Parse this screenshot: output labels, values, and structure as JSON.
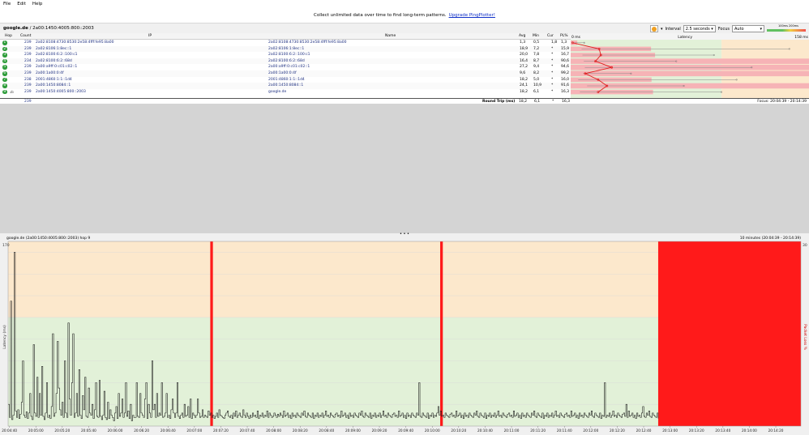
{
  "menu": [
    "File",
    "Edit",
    "Help"
  ],
  "banner": {
    "text": "Collect unlimited data over time to find long-term patterns.",
    "link": "Upgrade PingPlotter!"
  },
  "target": {
    "host": "google.de",
    "ip": "/ 2a00:1450:4005:800::2003"
  },
  "toolbar": {
    "interval_label": "Interval",
    "interval_value": "2.5 seconds",
    "focus_label": "Focus",
    "focus_value": "Auto",
    "legend_low": "100ms",
    "legend_high": "200ms"
  },
  "columns": {
    "hop": "Hop",
    "count": "Count",
    "ip": "IP",
    "name": "Name",
    "avg": "Avg",
    "min": "Min",
    "cur": "Cur",
    "pl": "PL%",
    "latency": "Latency",
    "lat_min": "0 ms",
    "lat_max": "158 ms"
  },
  "hops": [
    {
      "hop": "1",
      "count": "239",
      "ip": "2a02:8108:4730:8530:2e58:4fff:fe95:8a00",
      "name": "2a02:8108:4730:8530:2e58:4fff:fe95:8a00",
      "avg": "1,3",
      "min": "0,5",
      "cur": "1,8",
      "pl": "1,3",
      "plnum": 1.3,
      "avgnum": 1.3,
      "minnum": 0.5,
      "maxnum": 9
    },
    {
      "hop": "2",
      "count": "239",
      "ip": "2a02:8106:1:8ec::1",
      "name": "2a02:8106:1:8ec::1",
      "avg": "18,9",
      "min": "7,2",
      "cur": "*",
      "pl": "15,9",
      "plnum": 15.9,
      "avgnum": 18.9,
      "minnum": 7.2,
      "maxnum": 145
    },
    {
      "hop": "3",
      "count": "239",
      "ip": "2a02:8100:6:2::100:c1",
      "name": "2a02:8100:6:2::100:c1",
      "avg": "20,0",
      "min": "7,8",
      "cur": "*",
      "pl": "16,7",
      "plnum": 16.7,
      "avgnum": 20.0,
      "minnum": 7.8,
      "maxnum": 95
    },
    {
      "hop": "4",
      "count": "234",
      "ip": "2a02:8100:6:2::68d",
      "name": "2a02:8100:6:2::68d",
      "avg": "16,4",
      "min": "8,7",
      "cur": "*",
      "pl": "90,6",
      "plnum": 90.6,
      "avgnum": 16.4,
      "minnum": 8.7,
      "maxnum": 70
    },
    {
      "hop": "5",
      "count": "239",
      "ip": "2a00:a9ff:0:c01:c02::1",
      "name": "2a00:a9ff:0:c01:c02::1",
      "avg": "27,2",
      "min": "9,4",
      "cur": "*",
      "pl": "94,6",
      "plnum": 94.6,
      "avgnum": 27.2,
      "minnum": 9.4,
      "maxnum": 120
    },
    {
      "hop": "6",
      "count": "239",
      "ip": "2a00:1a00:0:4f",
      "name": "2a00:1a00:0:4f",
      "avg": "9,6",
      "min": "8,2",
      "cur": "*",
      "pl": "99,2",
      "plnum": 99.2,
      "avgnum": 9.6,
      "minnum": 8.2,
      "maxnum": 40
    },
    {
      "hop": "7",
      "count": "238",
      "ip": "2001:4860:1:1::1d4",
      "name": "2001:4860:1:1::1d4",
      "avg": "18,2",
      "min": "5,0",
      "cur": "*",
      "pl": "16,0",
      "plnum": 16.0,
      "avgnum": 18.2,
      "minnum": 5.0,
      "maxnum": 110
    },
    {
      "hop": "8",
      "count": "239",
      "ip": "2a00:1450:8084::1",
      "name": "2a00:1450:8084::1",
      "avg": "24,1",
      "min": "10,9",
      "cur": "*",
      "pl": "91,6",
      "plnum": 91.6,
      "avgnum": 24.1,
      "minnum": 10.9,
      "maxnum": 75
    },
    {
      "hop": "9",
      "count": "239",
      "ip": "2a00:1450:4005:800::2003",
      "name": "google.de",
      "avg": "18,2",
      "min": "6,1",
      "cur": "*",
      "pl": "16,3",
      "plnum": 16.3,
      "avgnum": 18.2,
      "minnum": 6.1,
      "maxnum": 100
    }
  ],
  "summary": {
    "count": "239",
    "label": "Round Trip (ms)",
    "avg": "18,2",
    "min": "6,1",
    "cur": "*",
    "pl": "16,3",
    "focus": "Focus: 20:04:39 - 20:14:39"
  },
  "graph": {
    "title": "google.de (2a00:1450:4005:800::2003) hop 9",
    "range": "10 minutes (20:04:39 - 20:14:39)",
    "ylabel": "Latency (ms)",
    "ylabel_right": "Packet Loss %",
    "ymax_label": "170",
    "right_max": "30"
  },
  "chart_data": {
    "type": "line",
    "ylim": [
      0,
      170
    ],
    "y2label": "Packet Loss %",
    "x_ticks": [
      "20:04:40",
      "20:05:00",
      "20:05:20",
      "20:05:40",
      "20:06:00",
      "20:06:20",
      "20:06:40",
      "20:07:00",
      "20:07:20",
      "20:07:40",
      "20:08:00",
      "20:08:20",
      "20:08:40",
      "20:09:00",
      "20:09:20",
      "20:09:40",
      "20:10:00",
      "20:10:20",
      "20:10:40",
      "20:11:00",
      "20:11:20",
      "20:11:40",
      "20:12:00",
      "20:12:20",
      "20:12:40",
      "20:13:00",
      "20:13:20",
      "20:13:40",
      "20:14:00",
      "20:14:20"
    ],
    "loss_events": [
      {
        "start_s": 153,
        "end_s": 155
      },
      {
        "start_s": 327,
        "end_s": 329
      }
    ],
    "loss_region_start_s": 492,
    "total_s": 600,
    "latency": [
      20,
      8,
      115,
      6,
      10,
      160,
      14,
      8,
      15,
      7,
      11,
      22,
      60,
      10,
      8,
      13,
      7,
      12,
      30,
      9,
      6,
      75,
      12,
      9,
      45,
      8,
      30,
      10,
      55,
      9,
      6,
      12,
      40,
      8,
      10,
      7,
      18,
      85,
      9,
      12,
      30,
      78,
      35,
      15,
      10,
      22,
      8,
      60,
      12,
      8,
      95,
      25,
      10,
      40,
      85,
      8,
      12,
      30,
      9,
      52,
      10,
      7,
      28,
      15,
      45,
      9,
      8,
      35,
      12,
      10,
      20,
      7,
      15,
      40,
      9,
      8,
      42,
      9,
      6,
      10,
      32,
      8,
      6,
      22,
      7,
      15,
      10,
      8,
      5,
      12,
      18,
      7,
      30,
      9,
      12,
      25,
      8,
      12,
      40,
      9,
      14,
      7,
      20,
      5,
      10,
      8,
      8,
      40,
      9,
      8,
      30,
      12,
      10,
      8,
      25,
      40,
      7,
      20,
      12,
      8,
      60,
      15,
      20,
      8,
      30,
      9,
      12,
      10,
      40,
      8,
      9,
      12,
      30,
      8,
      10,
      7,
      15,
      25,
      12,
      8,
      12,
      40,
      9,
      7,
      10,
      12,
      8,
      20,
      9,
      10,
      18,
      8,
      25,
      7,
      12,
      10,
      8,
      10,
      25,
      12,
      8,
      9,
      15,
      8,
      10,
      9,
      8,
      14,
      10,
      12,
      8,
      10,
      7,
      9,
      12,
      8,
      15,
      10,
      9,
      8,
      7,
      10,
      12,
      14,
      9,
      8,
      10,
      7,
      12,
      9,
      14,
      8,
      10,
      12,
      9,
      8,
      15,
      10,
      8,
      12,
      9,
      7,
      10,
      8,
      12,
      9,
      10,
      8,
      14,
      7,
      10,
      9,
      12,
      8,
      10,
      9,
      14,
      8,
      12,
      10,
      8,
      9,
      12,
      10,
      8,
      11,
      9,
      12,
      10,
      8,
      14,
      9,
      10,
      12,
      8,
      10,
      7,
      12,
      9,
      10,
      8,
      12,
      10,
      9,
      8,
      12,
      10,
      14,
      9,
      8,
      12,
      10,
      9,
      8,
      12,
      7,
      10,
      9,
      12,
      8,
      10,
      9,
      12,
      8,
      10,
      14,
      9,
      10,
      8,
      12,
      10,
      9,
      8,
      11,
      12,
      9,
      10,
      8,
      14,
      9,
      10,
      12,
      8,
      10,
      7,
      12,
      9,
      10,
      8,
      12,
      10,
      9,
      8,
      12,
      10,
      14,
      9,
      8,
      12,
      10,
      9,
      8,
      12,
      7,
      10,
      9,
      12,
      8,
      10,
      9,
      12,
      8,
      10,
      14,
      9,
      10,
      8,
      12,
      10,
      9,
      8,
      11,
      12,
      9,
      10,
      8,
      14,
      9,
      10,
      12,
      8,
      10,
      7,
      12,
      9,
      10,
      8,
      12,
      10,
      9,
      8,
      12,
      10,
      40,
      9,
      8,
      12,
      10,
      9,
      8,
      12,
      7,
      10,
      9,
      12,
      8,
      10,
      9,
      12,
      18,
      10,
      14,
      9,
      10,
      8,
      12,
      10,
      9,
      8,
      11,
      12,
      9,
      10,
      8,
      14,
      9,
      10,
      12,
      8,
      10,
      7,
      12,
      9,
      10,
      8,
      12,
      10,
      9,
      8,
      12,
      10,
      14,
      9,
      8,
      12,
      10,
      9,
      8,
      12,
      7,
      10,
      9,
      12,
      8,
      10,
      9,
      12,
      8,
      10,
      14,
      9,
      10,
      8,
      12,
      10,
      9,
      8,
      11,
      12,
      9,
      10,
      8,
      14,
      9,
      10,
      12,
      8,
      10,
      7,
      12,
      9,
      10,
      8,
      12,
      10,
      9,
      8,
      12,
      10,
      14,
      9,
      8,
      12,
      10,
      9,
      8,
      12,
      7,
      10,
      9,
      12,
      8,
      10,
      9,
      12,
      8,
      10,
      14,
      9,
      10,
      8,
      12,
      10,
      9,
      8,
      11,
      12,
      9,
      10,
      8,
      14,
      9,
      10,
      12,
      8,
      10,
      7,
      12,
      9,
      10,
      8,
      12,
      10,
      9,
      8,
      12,
      10,
      14,
      9,
      8,
      12,
      10,
      9,
      8,
      12,
      7,
      10,
      9,
      40,
      8,
      10,
      9,
      12,
      8,
      10,
      14,
      9,
      10,
      8,
      12,
      10,
      9,
      8,
      11,
      12,
      9,
      20,
      8,
      14,
      9,
      10,
      12,
      8,
      10,
      7,
      12,
      9,
      10,
      8,
      12,
      18,
      9,
      8,
      12,
      10,
      14,
      9,
      8,
      12,
      10,
      9,
      8,
      12,
      7
    ]
  },
  "colors": {
    "green_zone": "#e2f1d8",
    "orange_zone": "#fce8cc",
    "loss_red": "#ff1a1a",
    "bar_pink": "#f6b3b6",
    "dot_green": "#2e9c3a"
  }
}
